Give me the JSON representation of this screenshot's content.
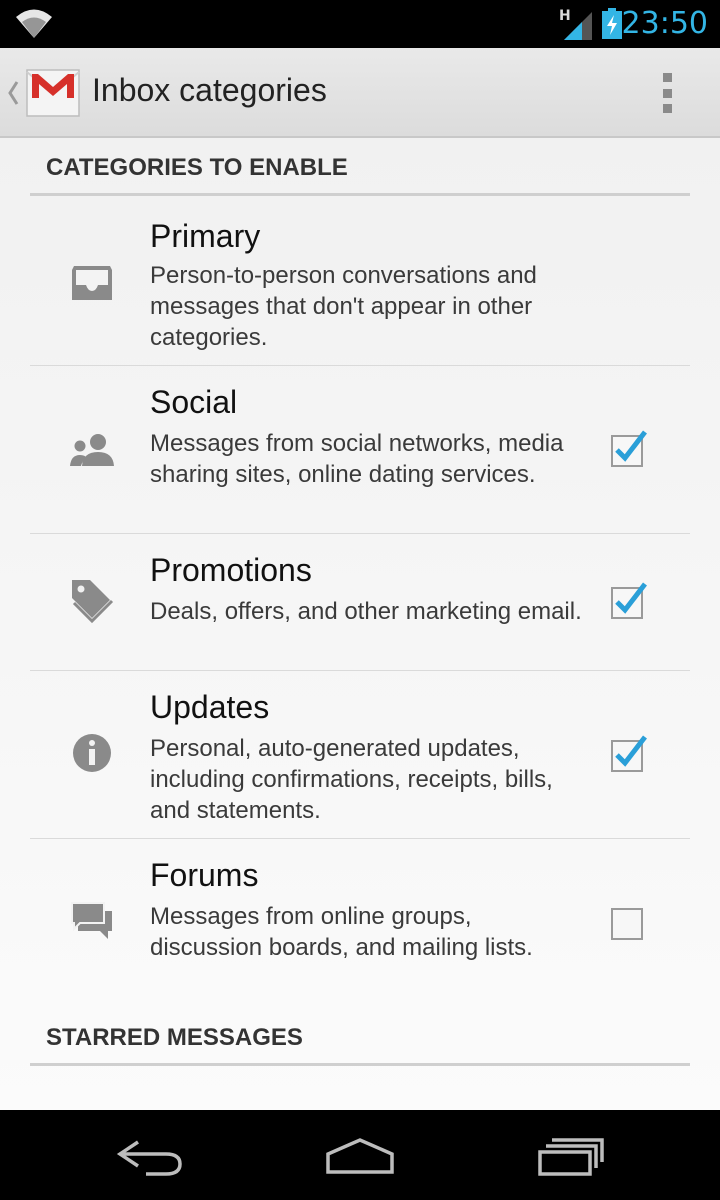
{
  "status_bar": {
    "network_type": "H",
    "time": "23:50"
  },
  "action_bar": {
    "title": "Inbox categories",
    "app_icon": "gmail-logo-icon",
    "overflow_icon": "overflow-menu-icon"
  },
  "sections": [
    {
      "header": "CATEGORIES TO ENABLE",
      "items": [
        {
          "icon": "inbox-tray-icon",
          "label": "Primary",
          "description": "Person-to-person conversations and messages that don't appear in other categories.",
          "has_checkbox": false
        },
        {
          "icon": "people-icon",
          "label": "Social",
          "description": "Messages from social networks, media sharing sites, online dating services.",
          "has_checkbox": true,
          "checked": true
        },
        {
          "icon": "tag-icon",
          "label": "Promotions",
          "description": "Deals, offers, and other marketing email.",
          "has_checkbox": true,
          "checked": true
        },
        {
          "icon": "info-icon",
          "label": "Updates",
          "description": "Personal, auto-generated updates, including confirmations, receipts, bills, and statements.",
          "has_checkbox": true,
          "checked": true
        },
        {
          "icon": "forum-chat-icon",
          "label": "Forums",
          "description": "Messages from online groups, discussion boards, and mailing lists.",
          "has_checkbox": true,
          "checked": false
        }
      ]
    },
    {
      "header": "STARRED MESSAGES",
      "items": []
    }
  ],
  "colors": {
    "accent": "#33b5e5",
    "icon_gray": "#8a8a8a",
    "check_blue": "#2a9fd8"
  }
}
